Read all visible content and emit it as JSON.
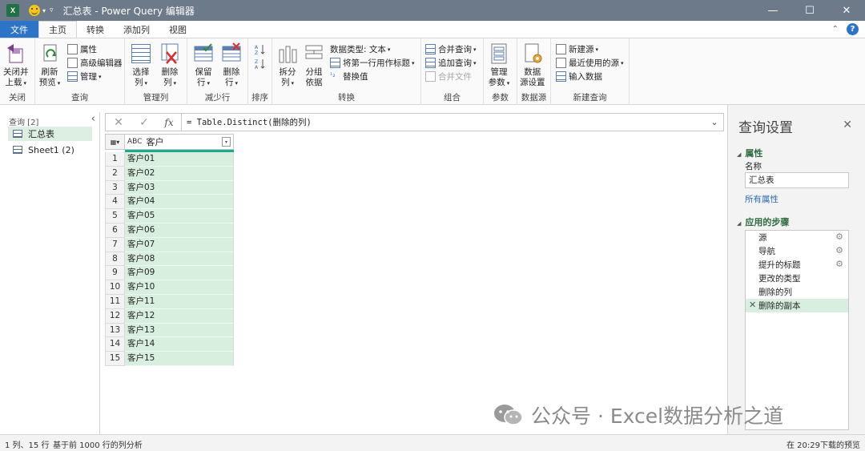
{
  "window": {
    "title": "汇总表 - Power Query 编辑器",
    "app_logo": "X",
    "qat_icon": "smiley-icon",
    "controls": [
      "—",
      "☐",
      "✕"
    ]
  },
  "tabs": {
    "file": "文件",
    "items": [
      "主页",
      "转换",
      "添加列",
      "视图"
    ],
    "active": "主页",
    "help": "?"
  },
  "ribbon": {
    "close": {
      "label1": "关闭并",
      "label2": "上载",
      "group": "关闭"
    },
    "query": {
      "refresh1": "刷新",
      "refresh2": "预览",
      "properties": "属性",
      "advanced_editor": "高级编辑器",
      "manage": "管理",
      "group": "查询"
    },
    "manage_columns": {
      "choose1": "选择",
      "choose2": "列",
      "remove1": "删除",
      "remove2": "列",
      "group": "管理列"
    },
    "reduce_rows": {
      "keep1": "保留",
      "keep2": "行",
      "remove1": "删除",
      "remove2": "行",
      "group": "减少行"
    },
    "sort": {
      "group": "排序"
    },
    "transform": {
      "split1": "拆分",
      "split2": "列",
      "groupby1": "分组",
      "groupby2": "依据",
      "datatype": "数据类型: 文本",
      "first_row_headers": "将第一行用作标题",
      "replace_values": "替换值",
      "group": "转换"
    },
    "combine": {
      "merge": "合并查询",
      "append": "追加查询",
      "combine_files": "合并文件",
      "group": "组合"
    },
    "parameters": {
      "label1": "管理",
      "label2": "参数",
      "group": "参数"
    },
    "datasource": {
      "label1": "数据",
      "label2": "源设置",
      "group": "数据源"
    },
    "new_query": {
      "new_source": "新建源",
      "recent_sources": "最近使用的源",
      "enter_data": "输入数据",
      "group": "新建查询"
    }
  },
  "queries": {
    "header": "查询 [2]",
    "items": [
      {
        "label": "汇总表",
        "selected": true
      },
      {
        "label": "Sheet1 (2)",
        "selected": false
      }
    ]
  },
  "formula_bar": {
    "formula": "= Table.Distinct(删除的列)",
    "fx": "fx"
  },
  "grid": {
    "column": {
      "type_icon": "ABC",
      "name": "客户"
    },
    "rows": [
      {
        "n": "1",
        "v": "客户01"
      },
      {
        "n": "2",
        "v": "客户02"
      },
      {
        "n": "3",
        "v": "客户03"
      },
      {
        "n": "4",
        "v": "客户04"
      },
      {
        "n": "5",
        "v": "客户05"
      },
      {
        "n": "6",
        "v": "客户06"
      },
      {
        "n": "7",
        "v": "客户07"
      },
      {
        "n": "8",
        "v": "客户08"
      },
      {
        "n": "9",
        "v": "客户09"
      },
      {
        "n": "10",
        "v": "客户10"
      },
      {
        "n": "11",
        "v": "客户11"
      },
      {
        "n": "12",
        "v": "客户12"
      },
      {
        "n": "13",
        "v": "客户13"
      },
      {
        "n": "14",
        "v": "客户14"
      },
      {
        "n": "15",
        "v": "客户15"
      }
    ]
  },
  "settings": {
    "title": "查询设置",
    "properties_header": "属性",
    "name_label": "名称",
    "name_value": "汇总表",
    "all_properties": "所有属性",
    "steps_header": "应用的步骤",
    "steps": [
      {
        "label": "源",
        "gear": true,
        "selected": false
      },
      {
        "label": "导航",
        "gear": true,
        "selected": false
      },
      {
        "label": "提升的标题",
        "gear": true,
        "selected": false
      },
      {
        "label": "更改的类型",
        "gear": false,
        "selected": false
      },
      {
        "label": "删除的列",
        "gear": false,
        "selected": false
      },
      {
        "label": "删除的副本",
        "gear": false,
        "selected": true
      }
    ]
  },
  "status": {
    "left": "1 列、15 行",
    "middle": "基于前 1000 行的列分析",
    "right": "在 20:29下载的预览"
  },
  "watermark": {
    "text": "公众号 · Excel数据分析之道",
    "icon": "wechat-icon"
  },
  "colors": {
    "titlebar": "#6c7a8a",
    "file_tab": "#2b74c7",
    "selection_green": "#d8efdf",
    "quality_bar": "#1faa8f"
  }
}
